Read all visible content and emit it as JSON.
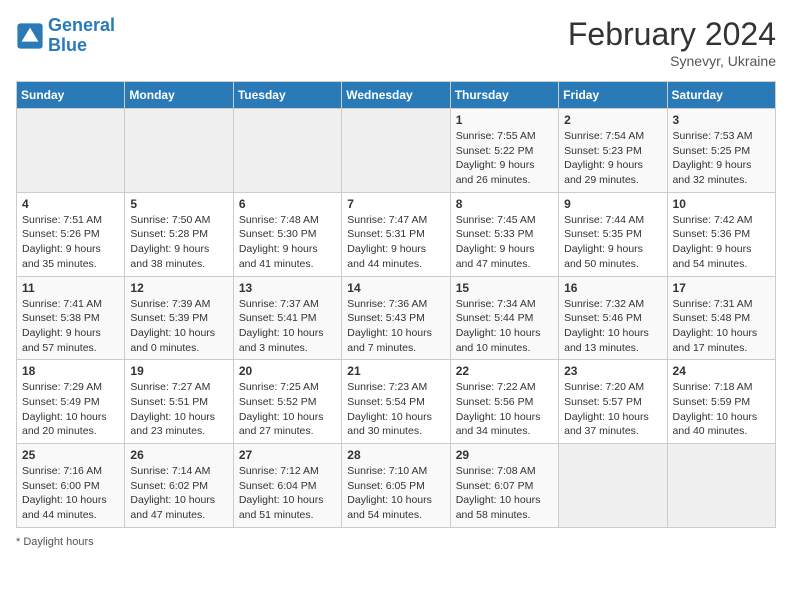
{
  "header": {
    "logo_line1": "General",
    "logo_line2": "Blue",
    "month_title": "February 2024",
    "subtitle": "Synevyr, Ukraine"
  },
  "days_of_week": [
    "Sunday",
    "Monday",
    "Tuesday",
    "Wednesday",
    "Thursday",
    "Friday",
    "Saturday"
  ],
  "weeks": [
    [
      {
        "day": "",
        "info": ""
      },
      {
        "day": "",
        "info": ""
      },
      {
        "day": "",
        "info": ""
      },
      {
        "day": "",
        "info": ""
      },
      {
        "day": "1",
        "info": "Sunrise: 7:55 AM\nSunset: 5:22 PM\nDaylight: 9 hours and 26 minutes."
      },
      {
        "day": "2",
        "info": "Sunrise: 7:54 AM\nSunset: 5:23 PM\nDaylight: 9 hours and 29 minutes."
      },
      {
        "day": "3",
        "info": "Sunrise: 7:53 AM\nSunset: 5:25 PM\nDaylight: 9 hours and 32 minutes."
      }
    ],
    [
      {
        "day": "4",
        "info": "Sunrise: 7:51 AM\nSunset: 5:26 PM\nDaylight: 9 hours and 35 minutes."
      },
      {
        "day": "5",
        "info": "Sunrise: 7:50 AM\nSunset: 5:28 PM\nDaylight: 9 hours and 38 minutes."
      },
      {
        "day": "6",
        "info": "Sunrise: 7:48 AM\nSunset: 5:30 PM\nDaylight: 9 hours and 41 minutes."
      },
      {
        "day": "7",
        "info": "Sunrise: 7:47 AM\nSunset: 5:31 PM\nDaylight: 9 hours and 44 minutes."
      },
      {
        "day": "8",
        "info": "Sunrise: 7:45 AM\nSunset: 5:33 PM\nDaylight: 9 hours and 47 minutes."
      },
      {
        "day": "9",
        "info": "Sunrise: 7:44 AM\nSunset: 5:35 PM\nDaylight: 9 hours and 50 minutes."
      },
      {
        "day": "10",
        "info": "Sunrise: 7:42 AM\nSunset: 5:36 PM\nDaylight: 9 hours and 54 minutes."
      }
    ],
    [
      {
        "day": "11",
        "info": "Sunrise: 7:41 AM\nSunset: 5:38 PM\nDaylight: 9 hours and 57 minutes."
      },
      {
        "day": "12",
        "info": "Sunrise: 7:39 AM\nSunset: 5:39 PM\nDaylight: 10 hours and 0 minutes."
      },
      {
        "day": "13",
        "info": "Sunrise: 7:37 AM\nSunset: 5:41 PM\nDaylight: 10 hours and 3 minutes."
      },
      {
        "day": "14",
        "info": "Sunrise: 7:36 AM\nSunset: 5:43 PM\nDaylight: 10 hours and 7 minutes."
      },
      {
        "day": "15",
        "info": "Sunrise: 7:34 AM\nSunset: 5:44 PM\nDaylight: 10 hours and 10 minutes."
      },
      {
        "day": "16",
        "info": "Sunrise: 7:32 AM\nSunset: 5:46 PM\nDaylight: 10 hours and 13 minutes."
      },
      {
        "day": "17",
        "info": "Sunrise: 7:31 AM\nSunset: 5:48 PM\nDaylight: 10 hours and 17 minutes."
      }
    ],
    [
      {
        "day": "18",
        "info": "Sunrise: 7:29 AM\nSunset: 5:49 PM\nDaylight: 10 hours and 20 minutes."
      },
      {
        "day": "19",
        "info": "Sunrise: 7:27 AM\nSunset: 5:51 PM\nDaylight: 10 hours and 23 minutes."
      },
      {
        "day": "20",
        "info": "Sunrise: 7:25 AM\nSunset: 5:52 PM\nDaylight: 10 hours and 27 minutes."
      },
      {
        "day": "21",
        "info": "Sunrise: 7:23 AM\nSunset: 5:54 PM\nDaylight: 10 hours and 30 minutes."
      },
      {
        "day": "22",
        "info": "Sunrise: 7:22 AM\nSunset: 5:56 PM\nDaylight: 10 hours and 34 minutes."
      },
      {
        "day": "23",
        "info": "Sunrise: 7:20 AM\nSunset: 5:57 PM\nDaylight: 10 hours and 37 minutes."
      },
      {
        "day": "24",
        "info": "Sunrise: 7:18 AM\nSunset: 5:59 PM\nDaylight: 10 hours and 40 minutes."
      }
    ],
    [
      {
        "day": "25",
        "info": "Sunrise: 7:16 AM\nSunset: 6:00 PM\nDaylight: 10 hours and 44 minutes."
      },
      {
        "day": "26",
        "info": "Sunrise: 7:14 AM\nSunset: 6:02 PM\nDaylight: 10 hours and 47 minutes."
      },
      {
        "day": "27",
        "info": "Sunrise: 7:12 AM\nSunset: 6:04 PM\nDaylight: 10 hours and 51 minutes."
      },
      {
        "day": "28",
        "info": "Sunrise: 7:10 AM\nSunset: 6:05 PM\nDaylight: 10 hours and 54 minutes."
      },
      {
        "day": "29",
        "info": "Sunrise: 7:08 AM\nSunset: 6:07 PM\nDaylight: 10 hours and 58 minutes."
      },
      {
        "day": "",
        "info": ""
      },
      {
        "day": "",
        "info": ""
      }
    ]
  ],
  "footer": {
    "note": "Daylight hours"
  }
}
